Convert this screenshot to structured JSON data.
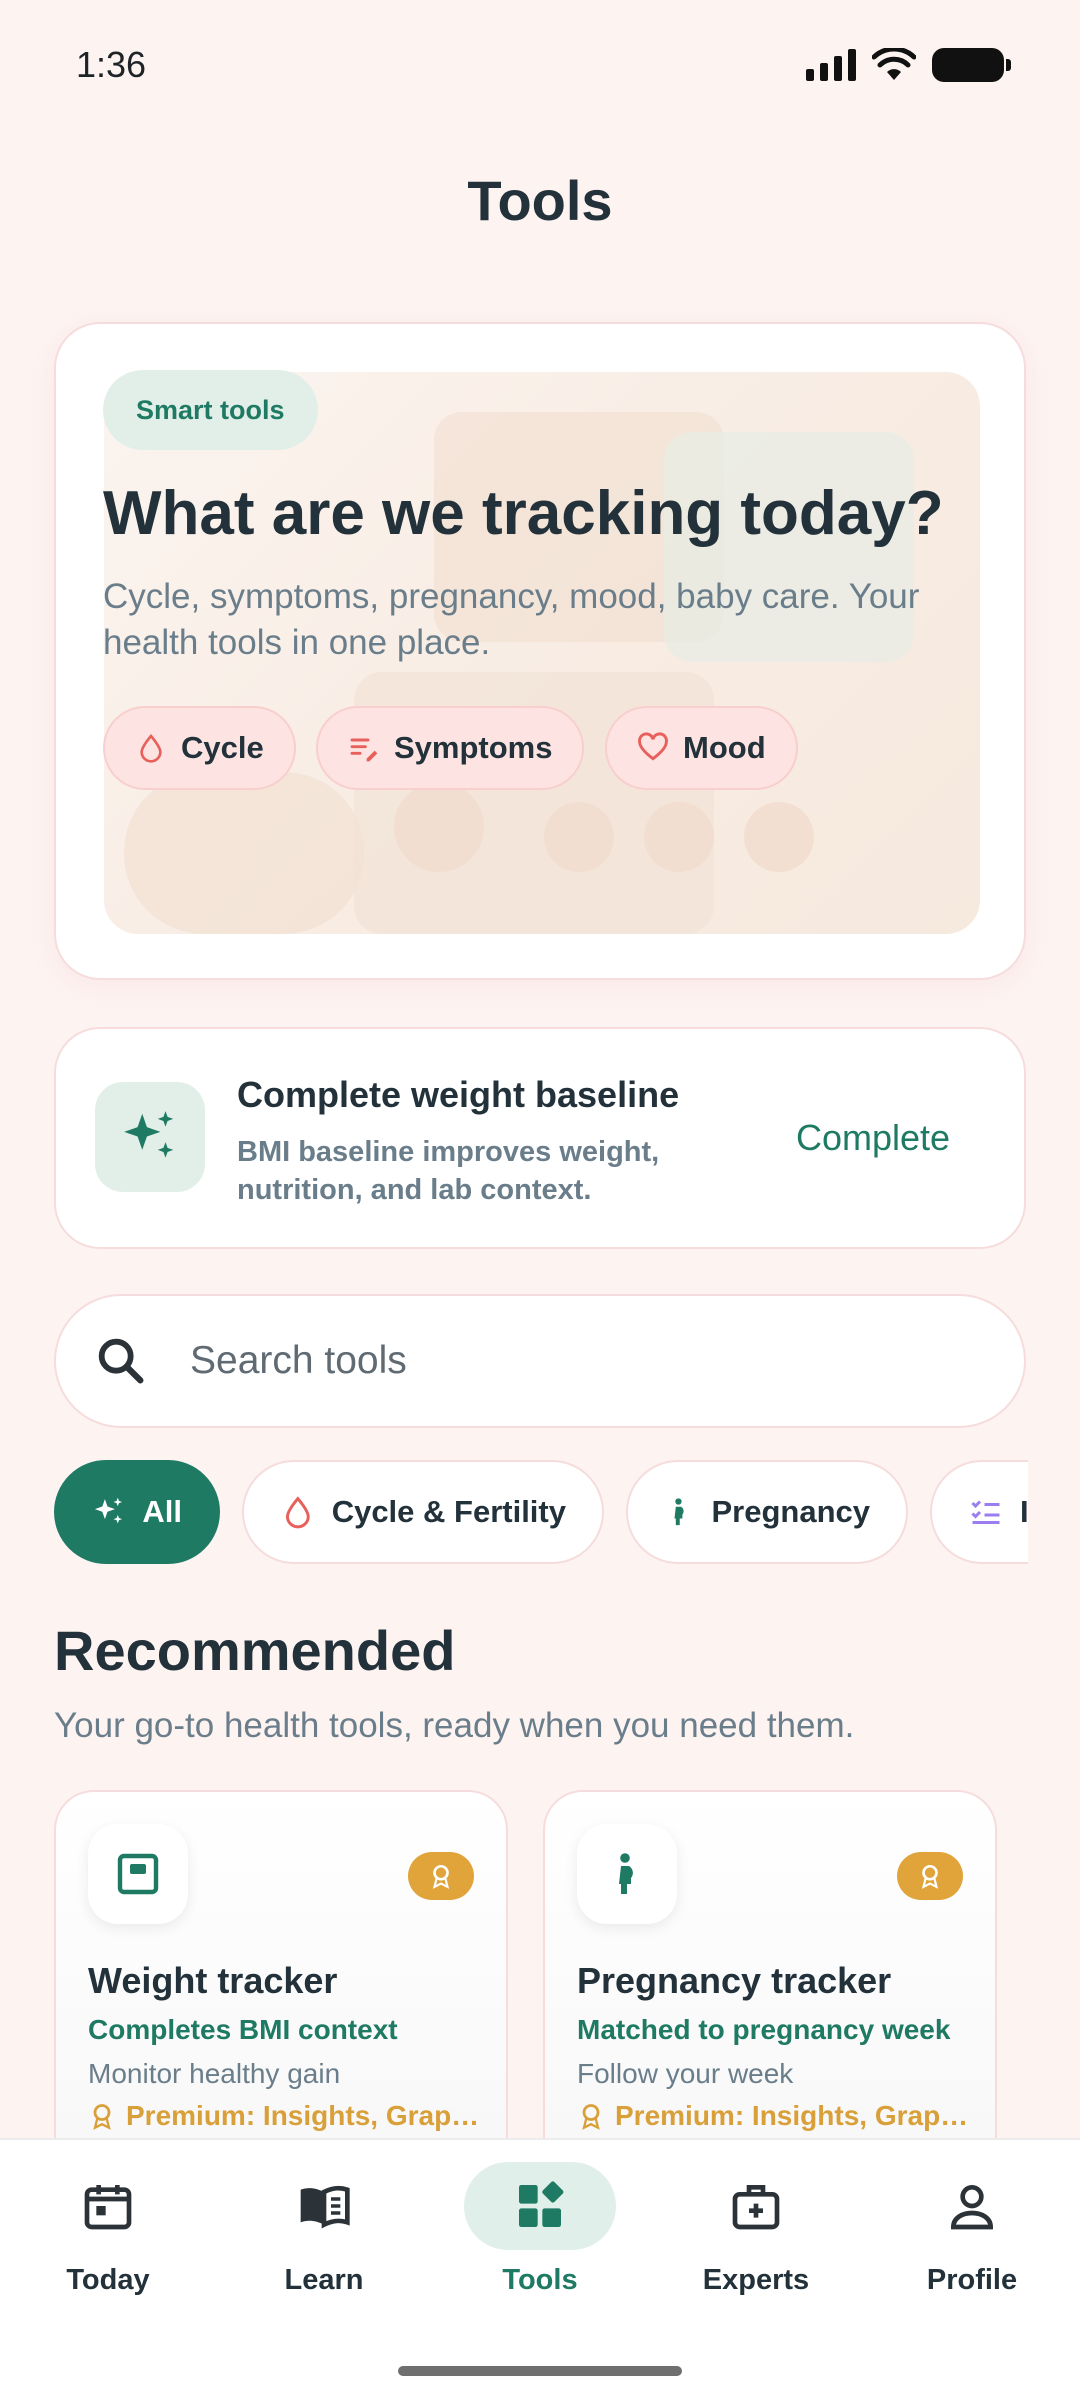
{
  "status_bar": {
    "time": "1:36"
  },
  "header": {
    "title": "Tools"
  },
  "hero": {
    "badge": "Smart tools",
    "heading": "What are we tracking today?",
    "description": "Cycle, symptoms, pregnancy, mood, baby care. Your health tools in one place.",
    "chips": [
      {
        "label": "Cycle",
        "icon": "drop-icon"
      },
      {
        "label": "Symptoms",
        "icon": "notes-icon"
      },
      {
        "label": "Mood",
        "icon": "heart-icon"
      }
    ]
  },
  "weight_card": {
    "title": "Complete weight baseline",
    "description": "BMI baseline improves weight, nutrition, and lab context.",
    "action": "Complete",
    "icon": "sparkles-icon"
  },
  "search": {
    "placeholder": "Search tools"
  },
  "filters": [
    {
      "label": "All",
      "icon": "sparkles-icon",
      "selected": true
    },
    {
      "label": "Cycle & Fertility",
      "icon": "drop-icon",
      "selected": false
    },
    {
      "label": "Pregnancy",
      "icon": "pregnant-icon",
      "selected": false
    },
    {
      "label": "I",
      "icon": "checklist-icon",
      "selected": false
    }
  ],
  "recommended": {
    "title": "Recommended",
    "subtitle": "Your go-to health tools, ready when you need them.",
    "cards": [
      {
        "name": "Weight tracker",
        "context": "Completes BMI context",
        "description": "Monitor healthy gain",
        "premium": "Premium: Insights, Grap…",
        "icon": "scale-icon"
      },
      {
        "name": "Pregnancy tracker",
        "context": "Matched to pregnancy week",
        "description": "Follow your week",
        "premium": "Premium: Insights, Grap…",
        "icon": "pregnant-icon"
      }
    ]
  },
  "bottom_nav": [
    {
      "label": "Today",
      "icon": "calendar-icon",
      "active": false
    },
    {
      "label": "Learn",
      "icon": "book-icon",
      "active": false
    },
    {
      "label": "Tools",
      "icon": "tools-grid-icon",
      "active": true
    },
    {
      "label": "Experts",
      "icon": "medical-bag-icon",
      "active": false
    },
    {
      "label": "Profile",
      "icon": "person-icon",
      "active": false
    }
  ],
  "colors": {
    "brand": "#1f7a63",
    "background": "#fdf3f1",
    "premium": "#e0a43a",
    "chip_bg": "#fde4e2"
  }
}
